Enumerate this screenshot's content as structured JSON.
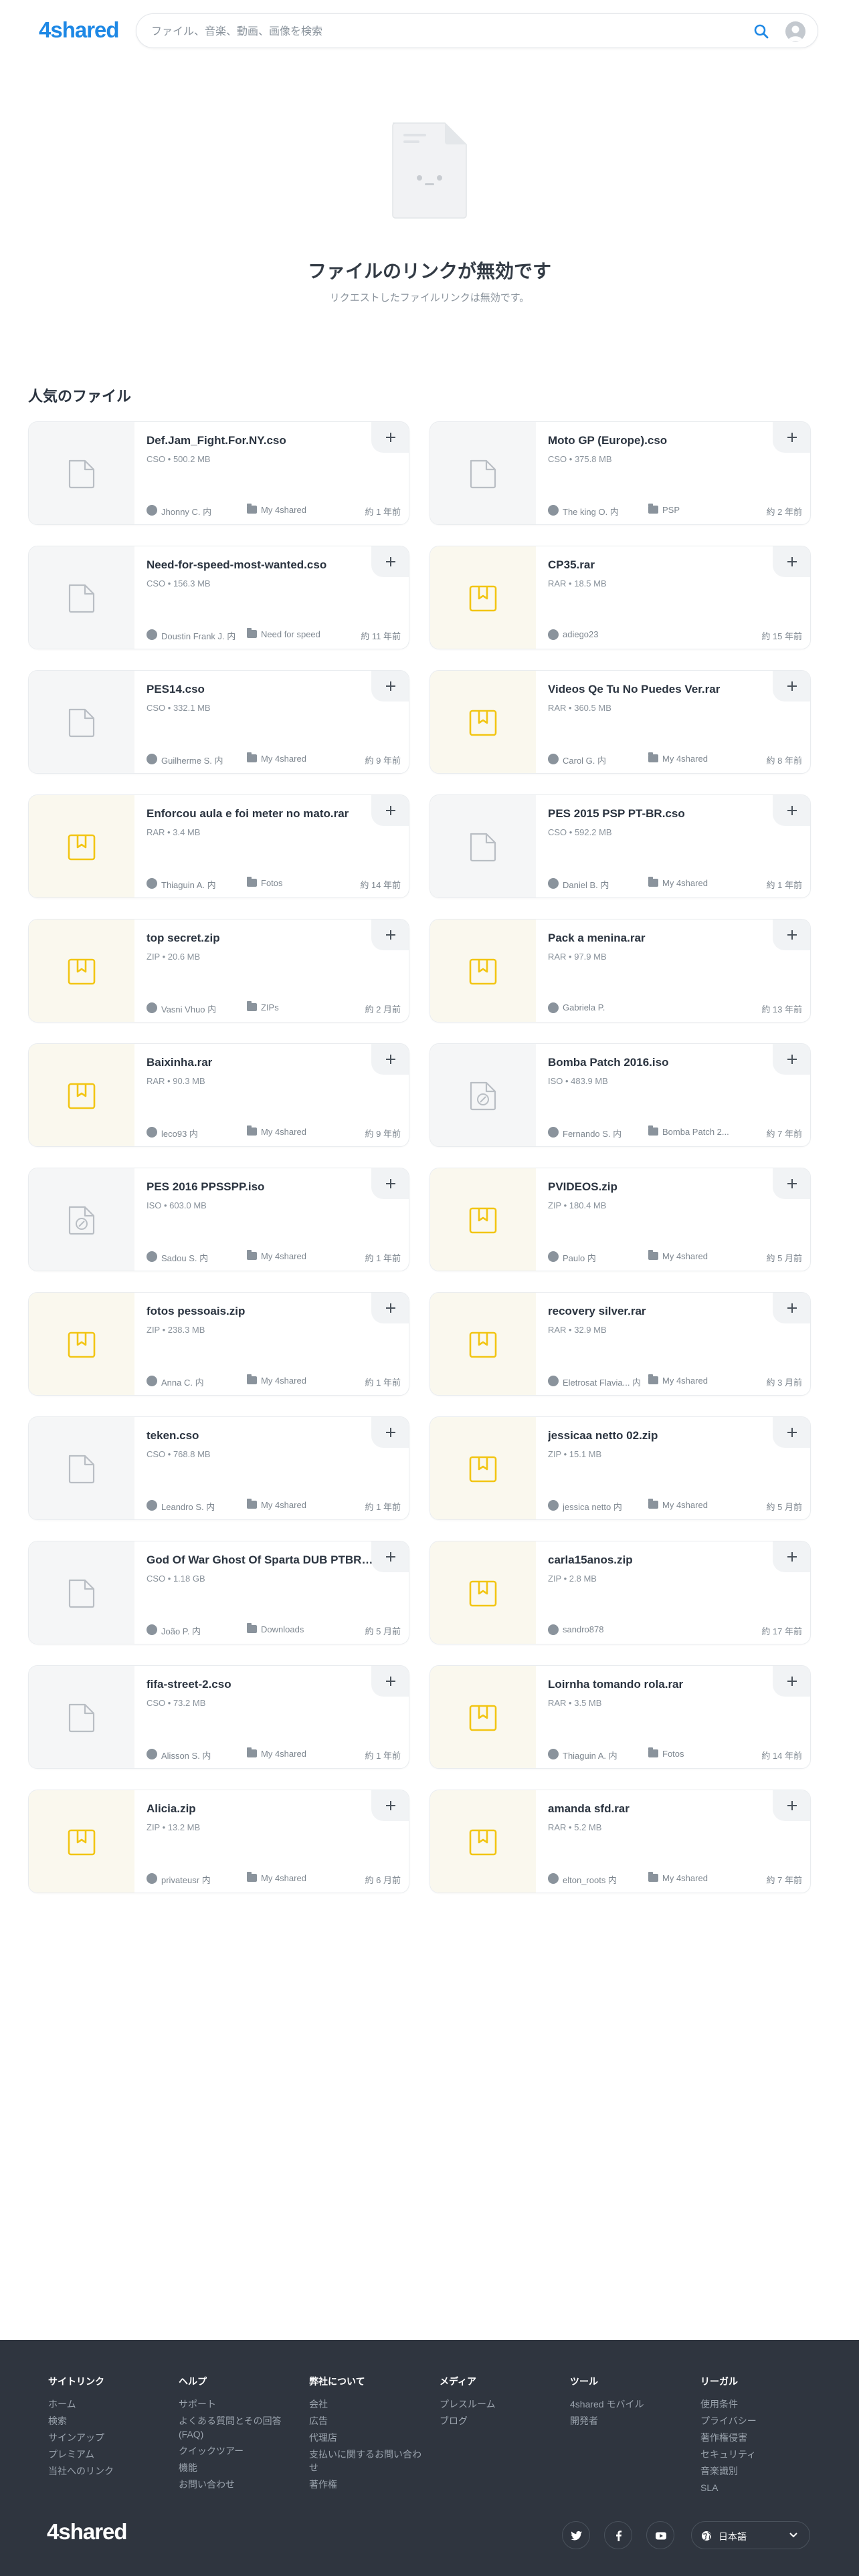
{
  "header": {
    "logo": "4shared",
    "search_placeholder": "ファイル、音楽、動画、画像を検索"
  },
  "empty": {
    "title": "ファイルのリンクが無効です",
    "subtitle": "リクエストしたファイルリンクは無効です。"
  },
  "section_title": "人気のファイル",
  "files": [
    {
      "name": "Def.Jam_Fight.For.NY.cso",
      "meta": "CSO • 500.2 MB",
      "owner": "Jhonny C. 内",
      "folder": "My 4shared",
      "ago": "約 1 年前",
      "kind": "file"
    },
    {
      "name": "Moto GP (Europe).cso",
      "meta": "CSO • 375.8 MB",
      "owner": "The king O. 内",
      "folder": "PSP",
      "ago": "約 2 年前",
      "kind": "file"
    },
    {
      "name": "Need-for-speed-most-wanted.cso",
      "meta": "CSO • 156.3 MB",
      "owner": "Doustin Frank J. 内",
      "folder": "Need for speed",
      "ago": "約 11 年前",
      "kind": "file"
    },
    {
      "name": "CP35.rar",
      "meta": "RAR • 18.5 MB",
      "owner": "adiego23",
      "folder": "",
      "ago": "約 15 年前",
      "kind": "archive"
    },
    {
      "name": "PES14.cso",
      "meta": "CSO • 332.1 MB",
      "owner": "Guilherme S. 内",
      "folder": "My 4shared",
      "ago": "約 9 年前",
      "kind": "file"
    },
    {
      "name": "Videos Qe Tu No Puedes Ver.rar",
      "meta": "RAR • 360.5 MB",
      "owner": "Carol G. 内",
      "folder": "My 4shared",
      "ago": "約 8 年前",
      "kind": "archive"
    },
    {
      "name": "Enforcou aula e foi meter no mato.rar",
      "meta": "RAR • 3.4 MB",
      "owner": "Thiaguin A. 内",
      "folder": "Fotos",
      "ago": "約 14 年前",
      "kind": "archive"
    },
    {
      "name": "PES 2015 PSP PT-BR.cso",
      "meta": "CSO • 592.2 MB",
      "owner": "Daniel B. 内",
      "folder": "My 4shared",
      "ago": "約 1 年前",
      "kind": "file"
    },
    {
      "name": "top secret.zip",
      "meta": "ZIP • 20.6 MB",
      "owner": "Vasni Vhuo 内",
      "folder": "ZIPs",
      "ago": "約 2 月前",
      "kind": "archive"
    },
    {
      "name": "Pack a menina.rar",
      "meta": "RAR • 97.9 MB",
      "owner": "Gabriela P.",
      "folder": "",
      "ago": "約 13 年前",
      "kind": "archive"
    },
    {
      "name": "Baixinha.rar",
      "meta": "RAR • 90.3 MB",
      "owner": "leco93 内",
      "folder": "My 4shared",
      "ago": "約 9 年前",
      "kind": "archive"
    },
    {
      "name": "Bomba Patch 2016.iso",
      "meta": "ISO • 483.9 MB",
      "owner": "Fernando S. 内",
      "folder": "Bomba Patch 2...",
      "ago": "約 7 年前",
      "kind": "disc"
    },
    {
      "name": "PES 2016 PPSSPP.iso",
      "meta": "ISO • 603.0 MB",
      "owner": "Sadou S. 内",
      "folder": "My 4shared",
      "ago": "約 1 年前",
      "kind": "disc"
    },
    {
      "name": "PVIDEOS.zip",
      "meta": "ZIP • 180.4 MB",
      "owner": "Paulo 内",
      "folder": "My 4shared",
      "ago": "約 5 月前",
      "kind": "archive"
    },
    {
      "name": "fotos pessoais.zip",
      "meta": "ZIP • 238.3 MB",
      "owner": "Anna C. 内",
      "folder": "My 4shared",
      "ago": "約 1 年前",
      "kind": "archive"
    },
    {
      "name": "recovery silver.rar",
      "meta": "RAR • 32.9 MB",
      "owner": "Eletrosat Flavia... 内",
      "folder": "My 4shared",
      "ago": "約 3 月前",
      "kind": "archive"
    },
    {
      "name": "teken.cso",
      "meta": "CSO • 768.8 MB",
      "owner": "Leandro S. 内",
      "folder": "My 4shared",
      "ago": "約 1 年前",
      "kind": "file"
    },
    {
      "name": "jessicaa netto 02.zip",
      "meta": "ZIP • 15.1 MB",
      "owner": "jessica netto 内",
      "folder": "My 4shared",
      "ago": "約 5 月前",
      "kind": "archive"
    },
    {
      "name": "God Of War Ghost Of Sparta DUB PTBR.cso",
      "meta": "CSO • 1.18 GB",
      "owner": "João P. 内",
      "folder": "Downloads",
      "ago": "約 5 月前",
      "kind": "file"
    },
    {
      "name": "carla15anos.zip",
      "meta": "ZIP • 2.8 MB",
      "owner": "sandro878",
      "folder": "",
      "ago": "約 17 年前",
      "kind": "archive"
    },
    {
      "name": "fifa-street-2.cso",
      "meta": "CSO • 73.2 MB",
      "owner": "Alisson S. 内",
      "folder": "My 4shared",
      "ago": "約 1 年前",
      "kind": "file"
    },
    {
      "name": "Loirnha tomando rola.rar",
      "meta": "RAR • 3.5 MB",
      "owner": "Thiaguin A. 内",
      "folder": "Fotos",
      "ago": "約 14 年前",
      "kind": "archive"
    },
    {
      "name": "Alicia.zip",
      "meta": "ZIP • 13.2 MB",
      "owner": "privateusr 内",
      "folder": "My 4shared",
      "ago": "約 6 月前",
      "kind": "archive"
    },
    {
      "name": "amanda sfd.rar",
      "meta": "RAR • 5.2 MB",
      "owner": "elton_roots 内",
      "folder": "My 4shared",
      "ago": "約 7 年前",
      "kind": "archive"
    }
  ],
  "footer": {
    "logo": "4shared",
    "columns": [
      {
        "title": "サイトリンク",
        "links": [
          "ホーム",
          "検索",
          "サインアップ",
          "プレミアム",
          "当社へのリンク"
        ]
      },
      {
        "title": "ヘルプ",
        "links": [
          "サポート",
          "よくある質問とその回答 (FAQ)",
          "クイックツアー",
          "機能",
          "お問い合わせ"
        ]
      },
      {
        "title": "弊社について",
        "links": [
          "会社",
          "広告",
          "代理店",
          "支払いに関するお問い合わせ",
          "著作権"
        ]
      },
      {
        "title": "メディア",
        "links": [
          "プレスルーム",
          "ブログ"
        ]
      },
      {
        "title": "ツール",
        "links": [
          "4shared モバイル",
          "開発者"
        ]
      },
      {
        "title": "リーガル",
        "links": [
          "使用条件",
          "プライバシー",
          "著作権侵害",
          "セキュリティ",
          "音楽識別",
          "SLA"
        ]
      }
    ],
    "language": "日本語"
  }
}
